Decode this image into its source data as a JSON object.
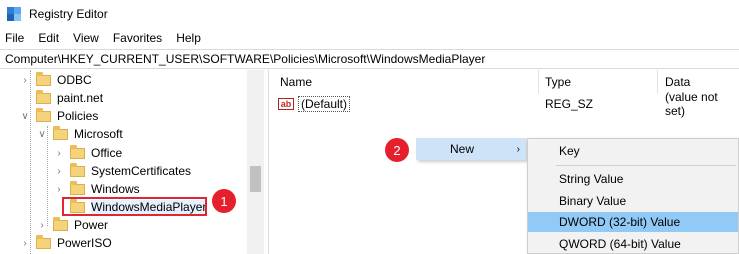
{
  "window": {
    "title": "Registry Editor",
    "icon_colors": [
      "#2f7fd6",
      "#5aa8ef",
      "#1f63b6",
      "#86c3f5"
    ]
  },
  "menubar": {
    "items": [
      "File",
      "Edit",
      "View",
      "Favorites",
      "Help"
    ]
  },
  "address": {
    "path": "Computer\\HKEY_CURRENT_USER\\SOFTWARE\\Policies\\Microsoft\\WindowsMediaPlayer"
  },
  "tree": {
    "items": [
      {
        "label": "ODBC",
        "expander": "collapsed"
      },
      {
        "label": "paint.net",
        "expander": "none"
      },
      {
        "label": "Policies",
        "expander": "expanded"
      },
      {
        "label": "Microsoft",
        "expander": "expanded"
      },
      {
        "label": "Office",
        "expander": "collapsed"
      },
      {
        "label": "SystemCertificates",
        "expander": "collapsed"
      },
      {
        "label": "Windows",
        "expander": "collapsed"
      },
      {
        "label": "WindowsMediaPlayer",
        "expander": "none",
        "selected": true
      },
      {
        "label": "Power",
        "expander": "collapsed"
      },
      {
        "label": "PowerISO",
        "expander": "collapsed"
      }
    ]
  },
  "list": {
    "columns": [
      "Name",
      "Type",
      "Data"
    ],
    "rows": [
      {
        "icon": "ab",
        "name": "(Default)",
        "type": "REG_SZ",
        "data": "(value not set)"
      }
    ]
  },
  "context_menu": {
    "new_label": "New",
    "submenu": [
      "Key",
      "String Value",
      "Binary Value",
      "DWORD (32-bit) Value",
      "QWORD (64-bit) Value"
    ]
  },
  "badges": {
    "one": "1",
    "two": "2"
  },
  "colors": {
    "highlight_red": "#e0262e",
    "badge_red": "#e5202c",
    "menu_hover": "#91c9f7",
    "new_hover": "#cfe3f8"
  }
}
